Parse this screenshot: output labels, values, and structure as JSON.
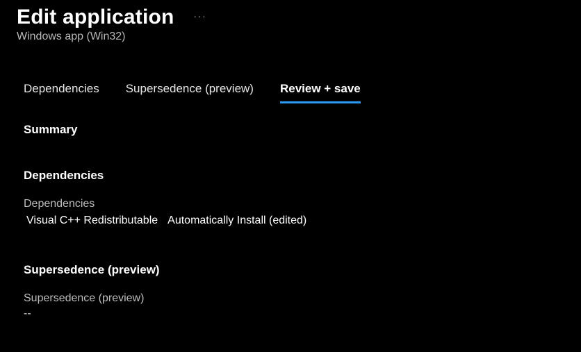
{
  "header": {
    "title": "Edit application",
    "subtitle": "Windows app (Win32)"
  },
  "tabs": [
    {
      "label": "Dependencies",
      "active": false
    },
    {
      "label": "Supersedence (preview)",
      "active": false
    },
    {
      "label": "Review + save",
      "active": true
    }
  ],
  "summary": {
    "title": "Summary"
  },
  "dependencies": {
    "title": "Dependencies",
    "label": "Dependencies",
    "name": "Visual C++ Redistributable",
    "action": "Automatically Install (edited)"
  },
  "supersedence": {
    "title": "Supersedence (preview)",
    "label": "Supersedence (preview)",
    "value": "--"
  }
}
